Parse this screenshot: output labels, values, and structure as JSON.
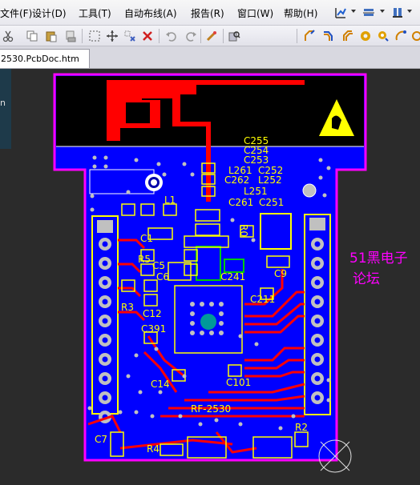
{
  "menus": [
    {
      "label": "文件(F)"
    },
    {
      "label": "设计(D)"
    },
    {
      "label": "工具(T)"
    },
    {
      "label": "自动布线(A)"
    },
    {
      "label": "报告(R)"
    },
    {
      "label": "窗口(W)"
    },
    {
      "label": "帮助(H)"
    }
  ],
  "document_tab": {
    "label": "2530.PcbDoc.htm"
  },
  "left_panel": {
    "text": "n"
  },
  "pcb": {
    "designators": {
      "c255": "C255",
      "c254": "C254",
      "c253": "C253",
      "l261": "L261",
      "c252": "C252",
      "c262": "C262",
      "l252": "L252",
      "l251": "L251",
      "c261": "C261",
      "c251": "C251",
      "l1": "L1",
      "c1": "C1",
      "r5": "R5",
      "c5": "C5",
      "c6": "C6",
      "c241": "C241",
      "c9": "C9",
      "r3": "R3",
      "c12": "C12",
      "c211": "C211",
      "c391": "C391",
      "c14": "C14",
      "c101": "C101",
      "rf2530": "RF-2530",
      "c7": "C7",
      "r4": "R4",
      "r2": "R2",
      "r0": "R0"
    },
    "forum_text_line1": "51黑电子",
    "forum_text_line2": "论坛"
  },
  "colors": {
    "board_blue": "#0000ff",
    "top_copper": "#ff0000",
    "silkscreen": "#ffff00",
    "outline": "#ff00ff",
    "pad_gray": "#c0c0c0",
    "via_teal": "#009999",
    "green_layer": "#00cc00",
    "antenna_area": "#000000"
  }
}
